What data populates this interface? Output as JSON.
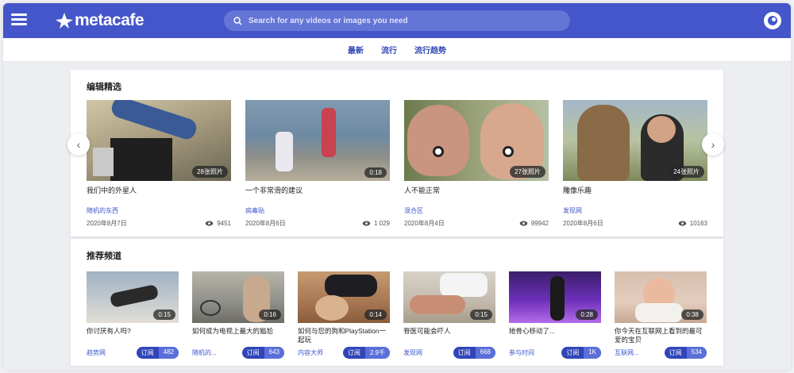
{
  "header": {
    "logo_text": "metacafe",
    "search_placeholder": "Search for any videos or images you need"
  },
  "nav": {
    "items": [
      "最新",
      "流行",
      "流行趋势"
    ]
  },
  "editors_pick": {
    "title": "编辑精选",
    "items": [
      {
        "badge": "28张照片",
        "title": "我们中的外星人",
        "channel": "随机的东西",
        "date": "2020年8月7日",
        "views": "9451"
      },
      {
        "badge": "0:18",
        "title": "一个非常滑的建议",
        "channel": "病毒贴",
        "date": "2020年8月6日",
        "views": "1 029"
      },
      {
        "badge": "27张照片",
        "title": "人不能正常",
        "channel": "混合区",
        "date": "2020年8月4日",
        "views": "99942"
      },
      {
        "badge": "24张照片",
        "title": "雕像乐趣",
        "channel": "发现网",
        "date": "2020年8月6日",
        "views": "10163"
      }
    ]
  },
  "recommended": {
    "title": "推荐频道",
    "subscribe_label": "订阅",
    "items": [
      {
        "badge": "0:15",
        "title": "你讨厌有人吗?",
        "channel": "趋势网",
        "subs": "482"
      },
      {
        "badge": "0:16",
        "title": "如何成为电视上最大的尴尬",
        "channel": "随机的...",
        "subs": "643"
      },
      {
        "badge": "0:14",
        "title": "如何与您的狗和PlayStation一起玩",
        "channel": "内容大师",
        "subs": "2.9千"
      },
      {
        "badge": "0:15",
        "title": "脊医可能会吓人",
        "channel": "发现网",
        "subs": "668"
      },
      {
        "badge": "0:28",
        "title": "她骨心移动了...",
        "channel": "参与时间",
        "subs": "1K"
      },
      {
        "badge": "0:38",
        "title": "你今天在互联网上看到的最可爱的宝贝",
        "channel": "互联网...",
        "subs": "534"
      }
    ]
  },
  "colors": {
    "brand": "#4456c9",
    "link": "#3b56c9",
    "subscribe": "#3046b8"
  }
}
